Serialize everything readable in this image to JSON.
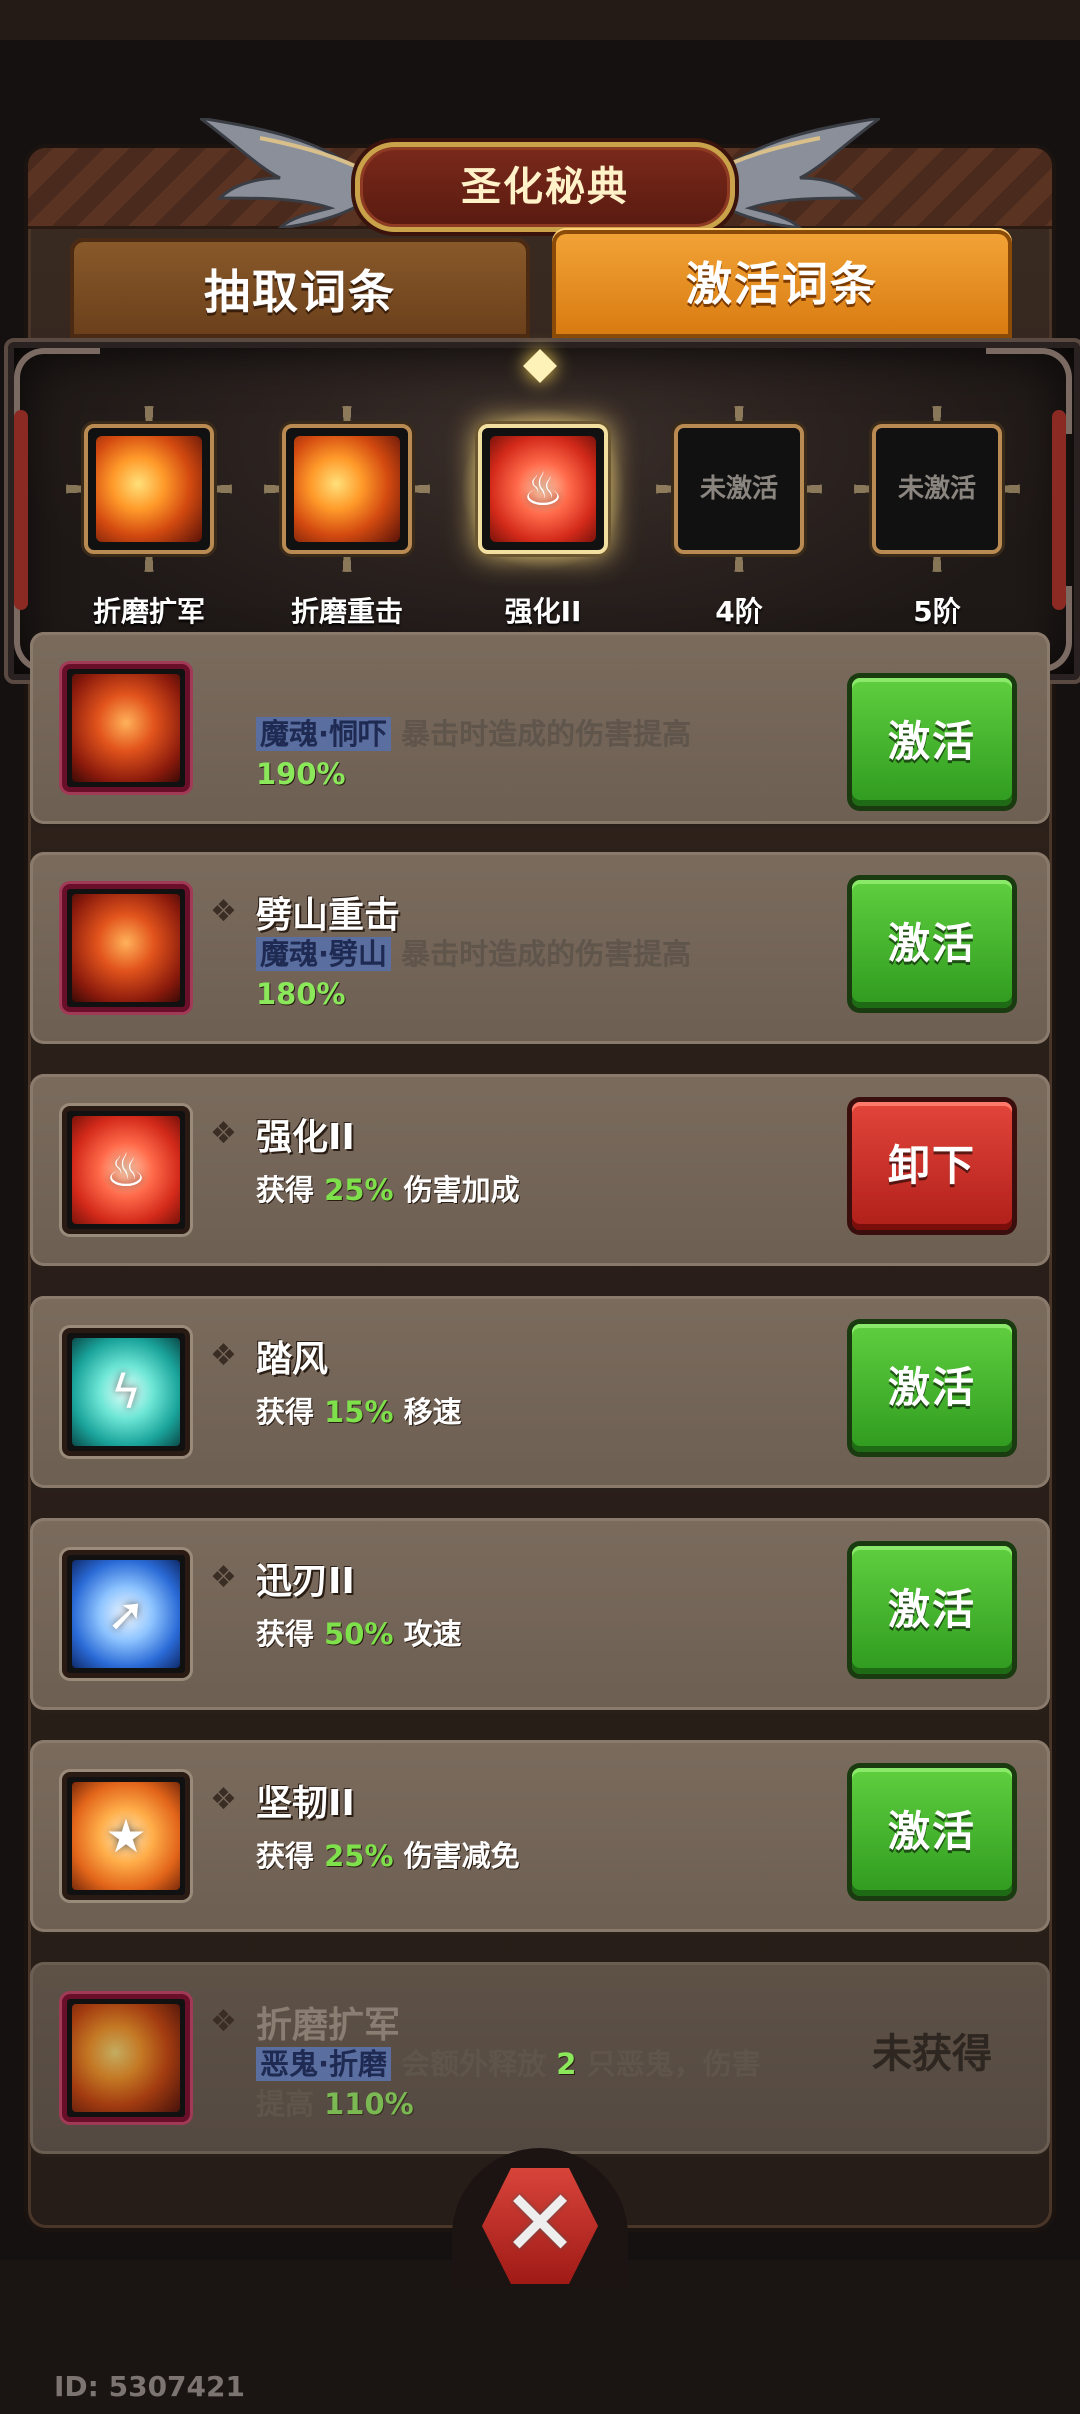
{
  "header": {
    "title": "圣化秘典"
  },
  "tabs": [
    {
      "label": "抽取词条",
      "active": false
    },
    {
      "label": "激活词条",
      "active": true
    }
  ],
  "slots": [
    {
      "label": "折磨扩军",
      "state": "filled",
      "icon": "fire-orb-icon"
    },
    {
      "label": "折磨重击",
      "state": "filled",
      "icon": "fire-orb-icon"
    },
    {
      "label": "强化II",
      "state": "selected",
      "icon": "red-burst-icon"
    },
    {
      "label": "4阶",
      "state": "empty",
      "empty_text": "未激活"
    },
    {
      "label": "5阶",
      "state": "empty",
      "empty_text": "未激活"
    }
  ],
  "cards": [
    {
      "name": "",
      "keyword": "魔魂·恫吓",
      "desc_rest": "暴击时造成的伤害提高",
      "value": "190%",
      "button": "激活",
      "button_type": "green",
      "icon": "demon-head-icon"
    },
    {
      "name": "劈山重击",
      "keyword": "魔魂·劈山",
      "desc_rest": "暴击时造成的伤害提高",
      "value": "180%",
      "button": "激活",
      "button_type": "green",
      "icon": "demon-head-icon"
    },
    {
      "name": "强化II",
      "pre": "获得",
      "value": "25%",
      "post": "伤害加成",
      "button": "卸下",
      "button_type": "red",
      "icon": "red-burst-icon"
    },
    {
      "name": "踏风",
      "pre": "获得",
      "value": "15%",
      "post": "移速",
      "button": "激活",
      "button_type": "green",
      "icon": "wind-boot-icon"
    },
    {
      "name": "迅刃II",
      "pre": "获得",
      "value": "50%",
      "post": "攻速",
      "button": "激活",
      "button_type": "green",
      "icon": "blade-arrow-icon"
    },
    {
      "name": "坚韧II",
      "pre": "获得",
      "value": "25%",
      "post": "伤害减免",
      "button": "激活",
      "button_type": "green",
      "icon": "shield-star-icon"
    },
    {
      "name": "折磨扩军",
      "keyword": "恶鬼·折磨",
      "desc_a": "会额外释放",
      "count": "2",
      "desc_b": "只恶鬼，伤害",
      "desc_c": "提高",
      "value": "110%",
      "status": "未获得",
      "icon": "fire-orb-icon"
    }
  ],
  "footer": {
    "id_text": "ID: 5307421"
  },
  "colors": {
    "activate_green": "#3fae2a",
    "unequip_red": "#c8302a",
    "highlight_green": "#7ee04a",
    "tab_active": "#e88f22"
  }
}
